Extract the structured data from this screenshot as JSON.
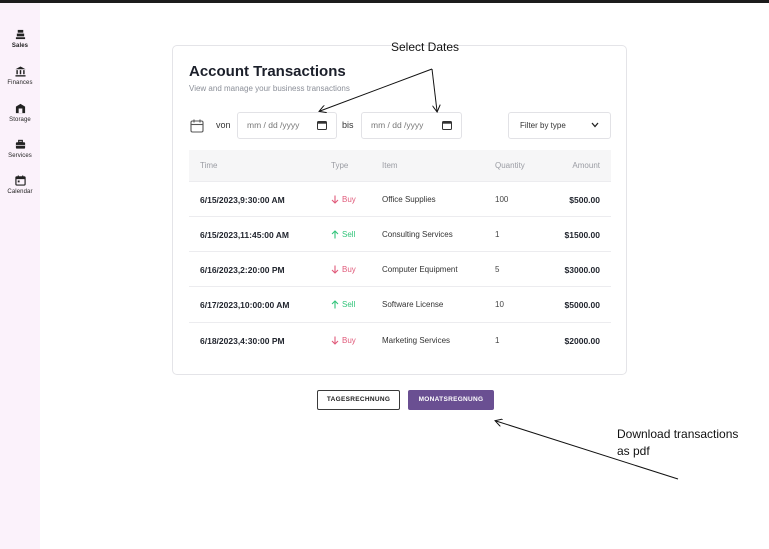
{
  "sidebar": {
    "items": [
      {
        "label": "Sales",
        "icon": "cash-register-icon"
      },
      {
        "label": "Finances",
        "icon": "bank-icon"
      },
      {
        "label": "Storage",
        "icon": "warehouse-icon"
      },
      {
        "label": "Services",
        "icon": "briefcase-icon"
      },
      {
        "label": "Calendar",
        "icon": "calendar-icon"
      }
    ]
  },
  "main": {
    "title": "Account Transactions",
    "subtitle": "View and manage your business transactions",
    "filters": {
      "from_label": "von",
      "to_label": "bis",
      "from_placeholder": "mm / dd /yyyy",
      "to_placeholder": "mm / dd /yyyy",
      "type_filter": "Filter by type"
    },
    "table": {
      "columns": [
        "Time",
        "Type",
        "Item",
        "Quantity",
        "Amount"
      ],
      "rows": [
        {
          "time": "6/15/2023,9:30:00 AM",
          "type": "Buy",
          "item": "Office Supplies",
          "quantity": "100",
          "amount": "$500.00"
        },
        {
          "time": "6/15/2023,11:45:00 AM",
          "type": "Sell",
          "item": "Consulting Services",
          "quantity": "1",
          "amount": "$1500.00"
        },
        {
          "time": "6/16/2023,2:20:00 PM",
          "type": "Buy",
          "item": "Computer Equipment",
          "quantity": "5",
          "amount": "$3000.00"
        },
        {
          "time": "6/17/2023,10:00:00 AM",
          "type": "Sell",
          "item": "Software License",
          "quantity": "10",
          "amount": "$5000.00"
        },
        {
          "time": "6/18/2023,4:30:00 PM",
          "type": "Buy",
          "item": "Marketing Services",
          "quantity": "1",
          "amount": "$2000.00"
        }
      ]
    },
    "buttons": {
      "daily": "TAGESRECHNUNG",
      "monthly": "MONATSREGNUNG"
    }
  },
  "annotations": {
    "select_dates": "Select Dates",
    "download_line1": "Download transactions",
    "download_line2": "as pdf"
  },
  "colors": {
    "sidebar_bg": "#fbf2fb",
    "accent": "#6a4f92",
    "buy": "#e05a7a",
    "sell": "#32c47a"
  }
}
